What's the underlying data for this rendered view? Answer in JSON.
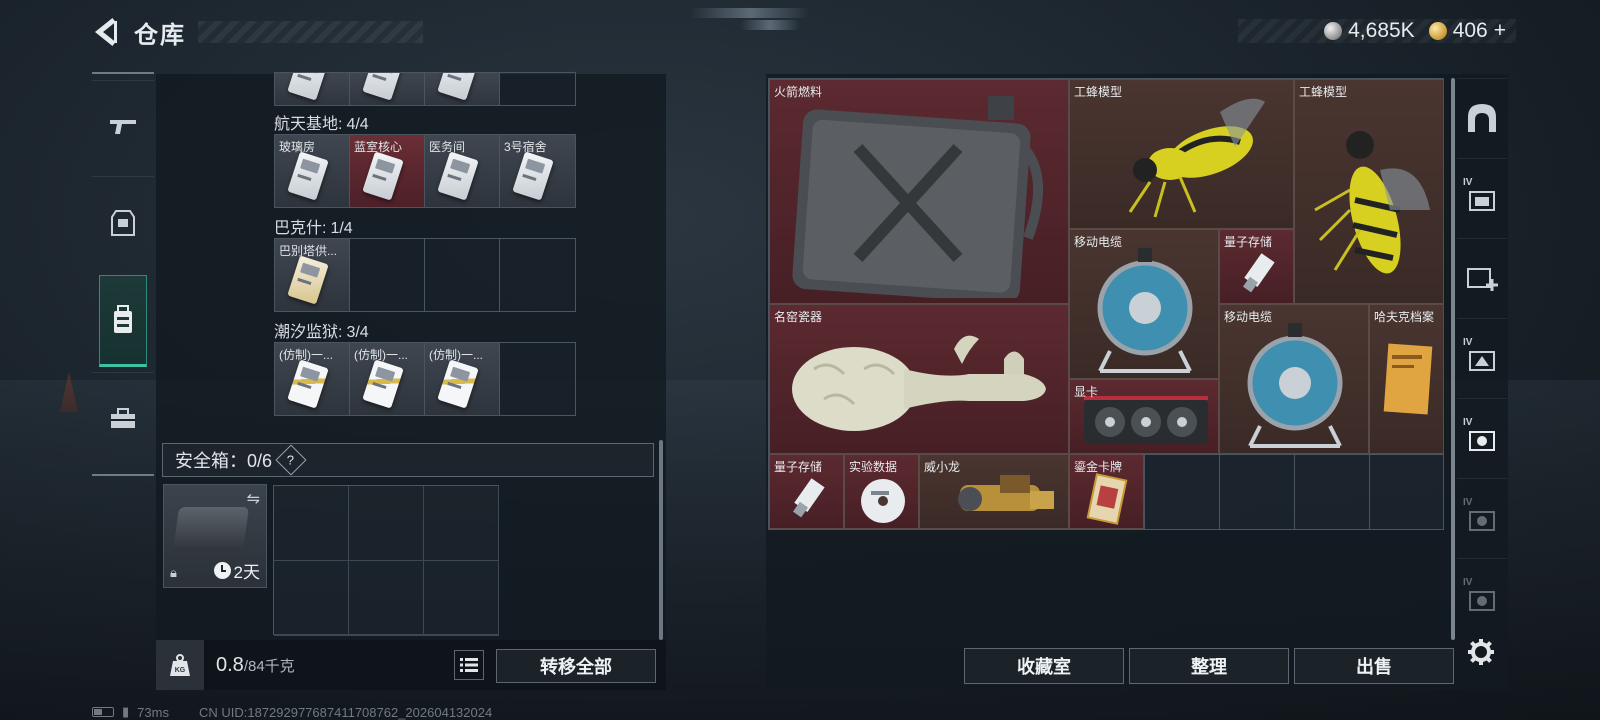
{
  "header": {
    "title": "仓库"
  },
  "currency": {
    "silver": "4,685K",
    "gold": "406",
    "add": "+"
  },
  "left_sidebar": {
    "tabs": [
      {
        "icon": "gun-icon"
      },
      {
        "icon": "armor-icon"
      },
      {
        "icon": "backpack-icon"
      },
      {
        "icon": "toolbox-icon"
      }
    ]
  },
  "keycard_sections": [
    {
      "name": "航天基地:",
      "count": "4/4",
      "cards": [
        "玻璃房",
        "蓝室核心",
        "医务间",
        "3号宿舍"
      ]
    },
    {
      "name": "巴克什:",
      "count": "1/4",
      "cards": [
        "巴别塔供..."
      ]
    },
    {
      "name": "潮汐监狱:",
      "count": "3/4",
      "cards": [
        "(仿制)一...",
        "(仿制)一...",
        "(仿制)一..."
      ]
    }
  ],
  "safe_box": {
    "label": "安全箱：0/6",
    "help": "?",
    "timer": "2天"
  },
  "bottom": {
    "weight": "0.8",
    "max_weight": "/84千克",
    "weight_icon": "KG",
    "transfer_all": "转移全部"
  },
  "stash": {
    "items": [
      {
        "label": "火箭燃料",
        "icon": "fuel-can-icon"
      },
      {
        "label": "工蜂模型",
        "icon": "wasp-model-icon"
      },
      {
        "label": "工蜂模型",
        "icon": "wasp-model-icon"
      },
      {
        "label": "移动电缆",
        "icon": "cable-reel-icon"
      },
      {
        "label": "量子存储",
        "icon": "usb-drive-icon"
      },
      {
        "label": "名窑瓷器",
        "icon": "porcelain-vase-icon"
      },
      {
        "label": "移动电缆",
        "icon": "cable-reel-icon"
      },
      {
        "label": "哈夫克档案",
        "icon": "folder-icon"
      },
      {
        "label": "显卡",
        "icon": "graphics-card-icon"
      },
      {
        "label": "量子存储",
        "icon": "usb-drive-icon"
      },
      {
        "label": "实验数据",
        "icon": "disc-icon"
      },
      {
        "label": "威小龙",
        "icon": "figure-icon"
      },
      {
        "label": "鎏金卡牌",
        "icon": "card-icon"
      }
    ]
  },
  "actions": {
    "collection": "收藏室",
    "organize": "整理",
    "sell": "出售"
  },
  "right_sidebar": {
    "tabs": [
      {
        "icon": "vault-icon",
        "tag": ""
      },
      {
        "icon": "stash-tier-icon",
        "tag": "IV"
      },
      {
        "icon": "add-slot-icon",
        "tag": ""
      },
      {
        "icon": "stash-tier-icon",
        "tag": "IV"
      },
      {
        "icon": "stash-tier-icon",
        "tag": "IV"
      },
      {
        "icon": "stash-tier-icon",
        "tag": "IV"
      },
      {
        "icon": "stash-tier-icon",
        "tag": "IV"
      }
    ]
  },
  "status_bar": {
    "ping": "73ms",
    "uid": "CN UID:1872929776874117087​62_202604132024"
  },
  "colors": {
    "accent": "#3fc2a4",
    "item_red": "#5c2a30",
    "item_brown": "#4a3530"
  }
}
